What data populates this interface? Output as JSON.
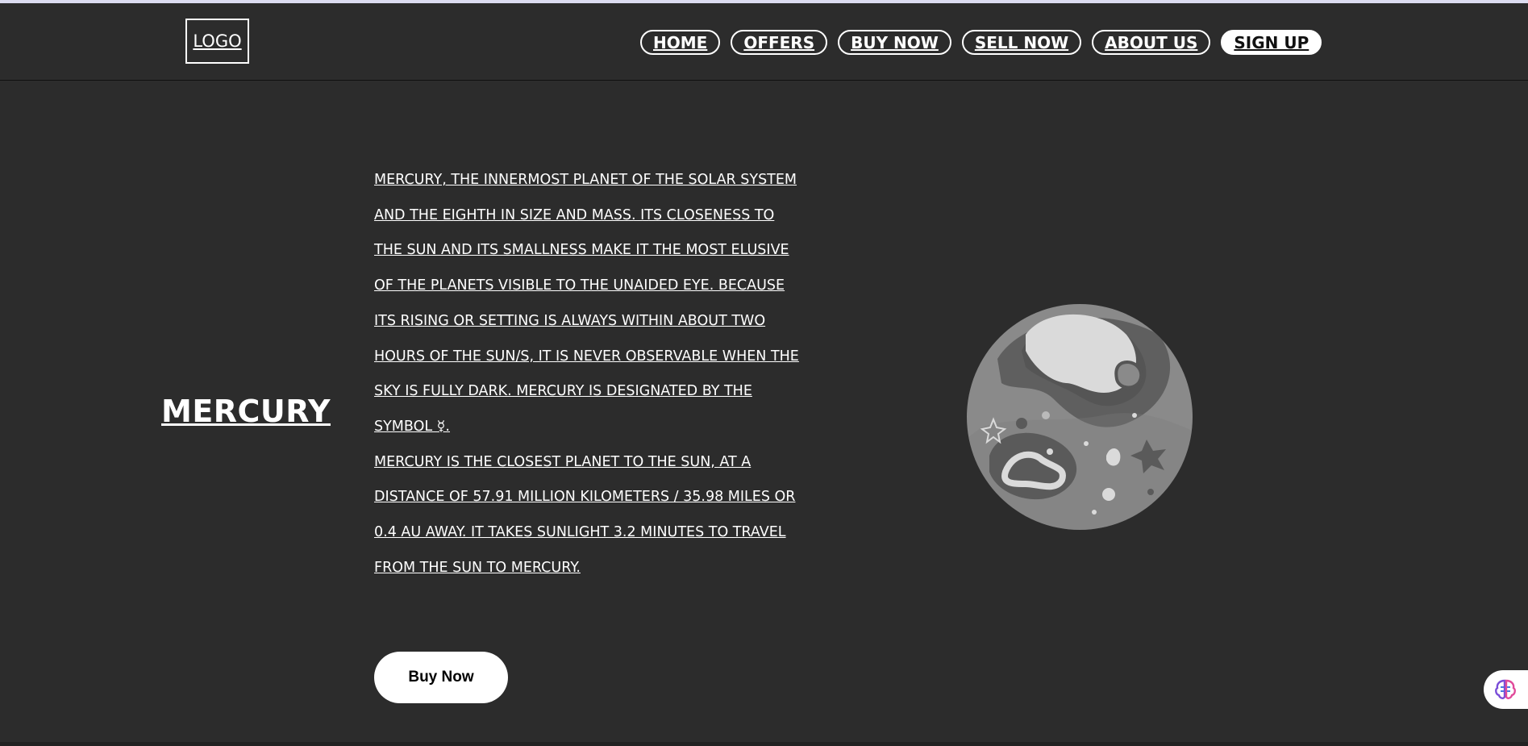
{
  "header": {
    "logo_label": "LOGO",
    "nav": [
      {
        "label": "HOME"
      },
      {
        "label": "OFFERS"
      },
      {
        "label": "BUY NOW"
      },
      {
        "label": "SELL NOW"
      },
      {
        "label": "ABOUT US"
      },
      {
        "label": "SIGN UP"
      }
    ]
  },
  "hero": {
    "title": "MERCURY",
    "paragraphs": [
      "Mercury, the innermost planet of the solar system and the eighth in size and mass. Its closeness to the Sun and its smallness make it the most elusive of the planets visible to the unaided eye. Because its rising or setting is always within about two hours of the Sun/s, it is never observable when the sky is fully dark. Mercury is designated by the symbol ☿.",
      "Mercury is the closest planet to the sun, at a distance of 57.91 million kilometers / 35.98 miles or 0.4 AU away. It takes sunlight 3.2 minutes to travel from the sun to Mercury."
    ],
    "buy_label": "Buy Now"
  },
  "colors": {
    "background": "#2c2c2c",
    "text": "#ffffff",
    "signup_bg": "#ffffff"
  },
  "icons": {
    "planet": "mercury-planet-illustration",
    "assistant": "brain-icon"
  }
}
